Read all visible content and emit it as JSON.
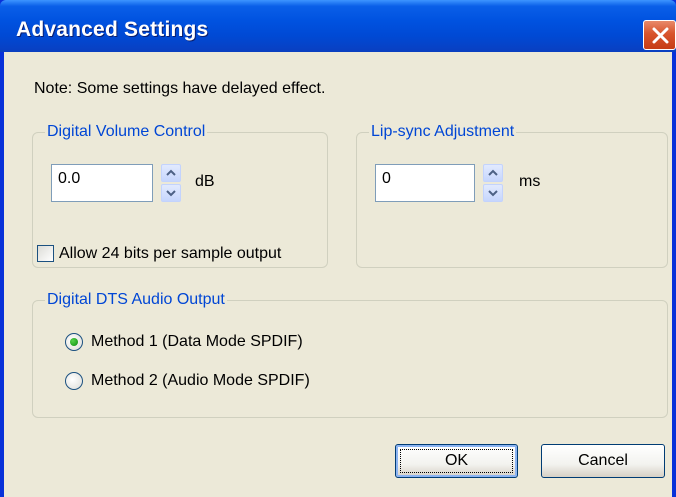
{
  "window": {
    "title": "Advanced Settings"
  },
  "note": "Note: Some settings have delayed effect.",
  "volume_group": {
    "label": "Digital Volume Control",
    "value": "0.0",
    "unit": "dB"
  },
  "lipsync_group": {
    "label": "Lip-sync Adjustment",
    "value": "0",
    "unit": "ms"
  },
  "allow24": {
    "label": "Allow 24 bits per sample output",
    "checked": false
  },
  "dts_group": {
    "label": "Digital DTS Audio Output",
    "options": [
      {
        "label": "Method 1 (Data Mode SPDIF)",
        "selected": true
      },
      {
        "label": "Method 2 (Audio Mode SPDIF)",
        "selected": false
      }
    ]
  },
  "buttons": {
    "ok": "OK",
    "cancel": "Cancel"
  },
  "colors": {
    "titlebar": "#0052e0",
    "group_label": "#0046d5",
    "dialog_bg": "#ece9d8",
    "close_button": "#d8542c"
  },
  "icons": {
    "close": "close-x-icon",
    "spin_up": "chevron-up-icon",
    "spin_down": "chevron-down-icon"
  }
}
